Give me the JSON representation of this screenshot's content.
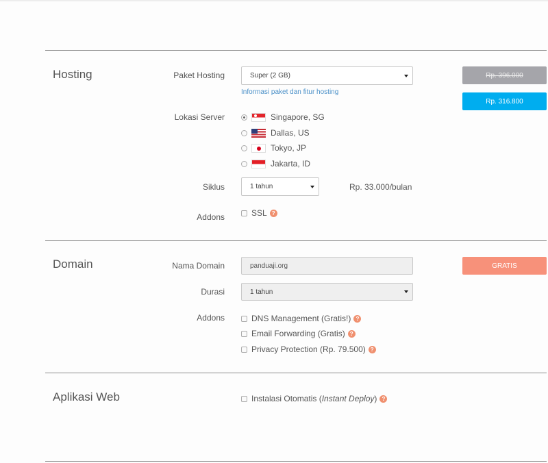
{
  "hosting": {
    "title": "Hosting",
    "paket": {
      "label": "Paket Hosting",
      "value": "Super (2 GB)",
      "link": "Informasi paket dan fitur hosting"
    },
    "lokasi": {
      "label": "Lokasi Server",
      "options": [
        {
          "label": "Singapore, SG",
          "flag": "sg-flag-icon",
          "selected": true
        },
        {
          "label": "Dallas, US",
          "flag": "us-flag-icon",
          "selected": false
        },
        {
          "label": "Tokyo, JP",
          "flag": "jp-flag-icon",
          "selected": false
        },
        {
          "label": "Jakarta, ID",
          "flag": "id-flag-icon",
          "selected": false
        }
      ]
    },
    "siklus": {
      "label": "Siklus",
      "value": "1 tahun",
      "price": "Rp. 33.000/bulan"
    },
    "addons": {
      "label": "Addons",
      "ssl": "SSL"
    },
    "price_original": "Rp. 396.000",
    "price_final": "Rp. 316.800"
  },
  "domain": {
    "title": "Domain",
    "nama": {
      "label": "Nama Domain",
      "value": "panduaji.org"
    },
    "durasi": {
      "label": "Durasi",
      "value": "1 tahun"
    },
    "addons": {
      "label": "Addons",
      "items": [
        "DNS Management (Gratis!)",
        "Email Forwarding (Gratis)",
        "Privacy Protection (Rp. 79.500)"
      ]
    },
    "price": "GRATIS"
  },
  "aplikasi": {
    "title": "Aplikasi Web",
    "instalasi_prefix": "Instalasi Otomatis (",
    "instalasi_italic": "Instant Deploy",
    "instalasi_suffix": ")"
  },
  "colors": {
    "accent_blue": "#00adef",
    "disabled_gray": "#a5a5aa",
    "gratis_salmon": "#f7917a",
    "help_icon": "#f0906f"
  }
}
